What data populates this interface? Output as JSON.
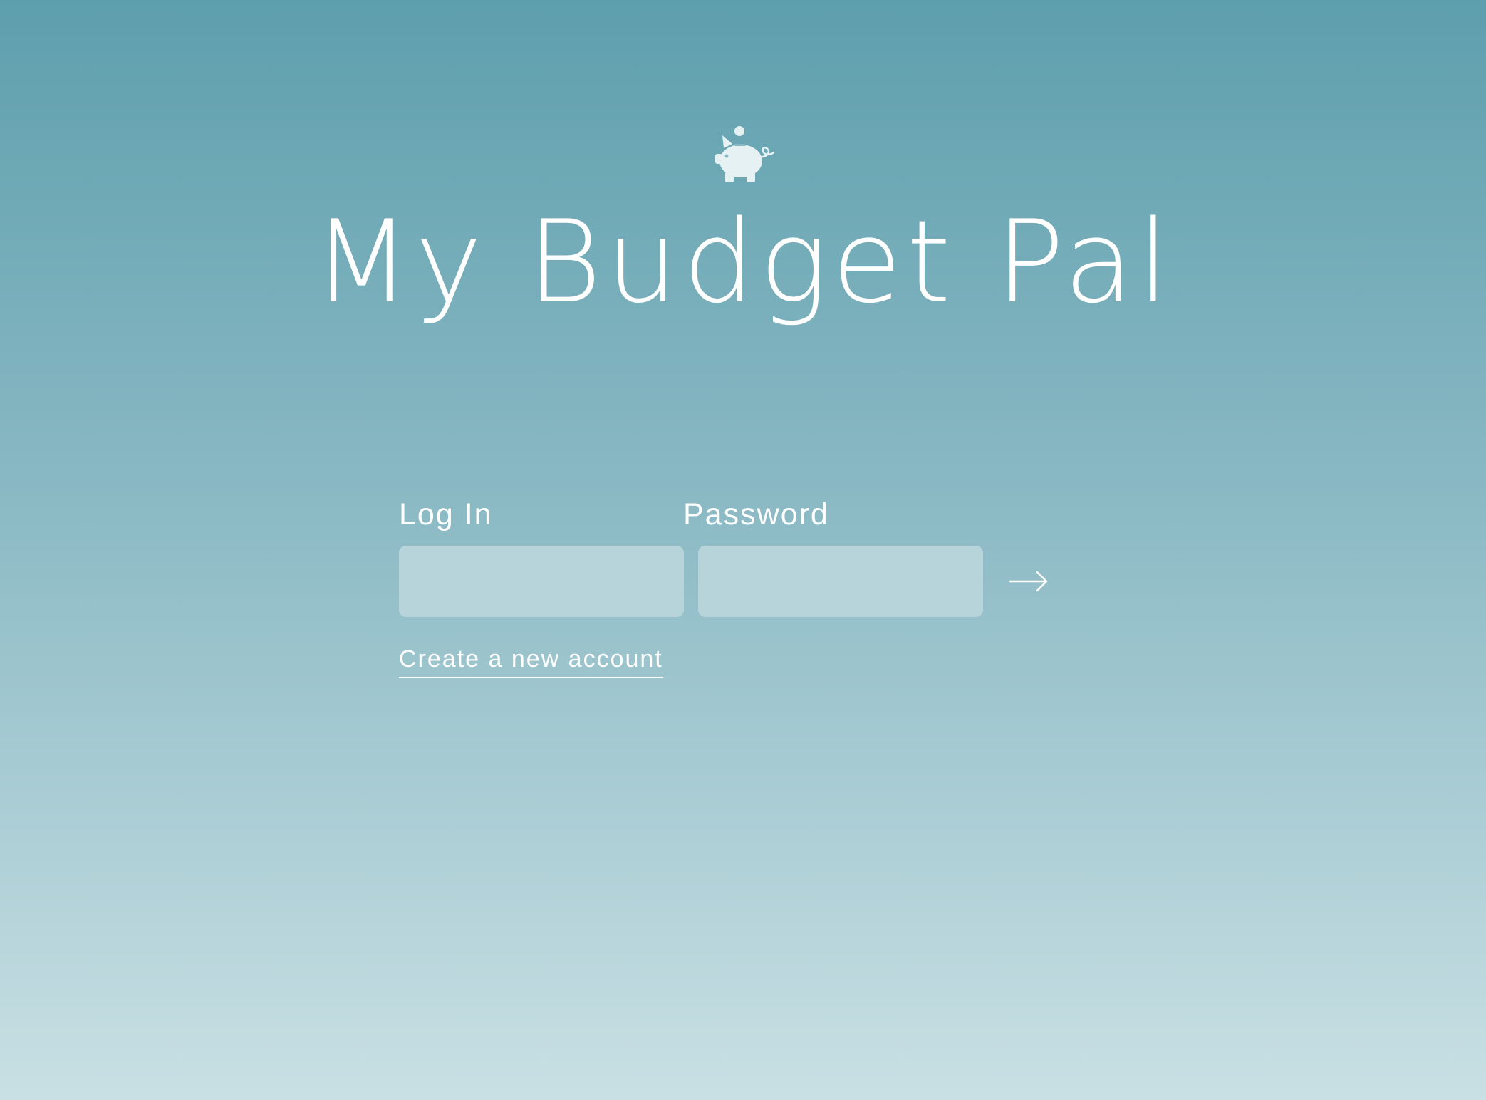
{
  "app": {
    "title": "My Budget Pal",
    "logo_icon": "piggy-bank-icon"
  },
  "login_form": {
    "login_label": "Log In",
    "login_value": "",
    "password_label": "Password",
    "password_value": "",
    "submit_icon": "arrow-right-icon",
    "create_account_link": "Create a new account"
  },
  "colors": {
    "background_top": "#5e9fad",
    "background_bottom": "#c9e0e4",
    "input_fill": "#b7d4da",
    "text": "#ffffff",
    "logo_fill": "#e6f1f3"
  }
}
